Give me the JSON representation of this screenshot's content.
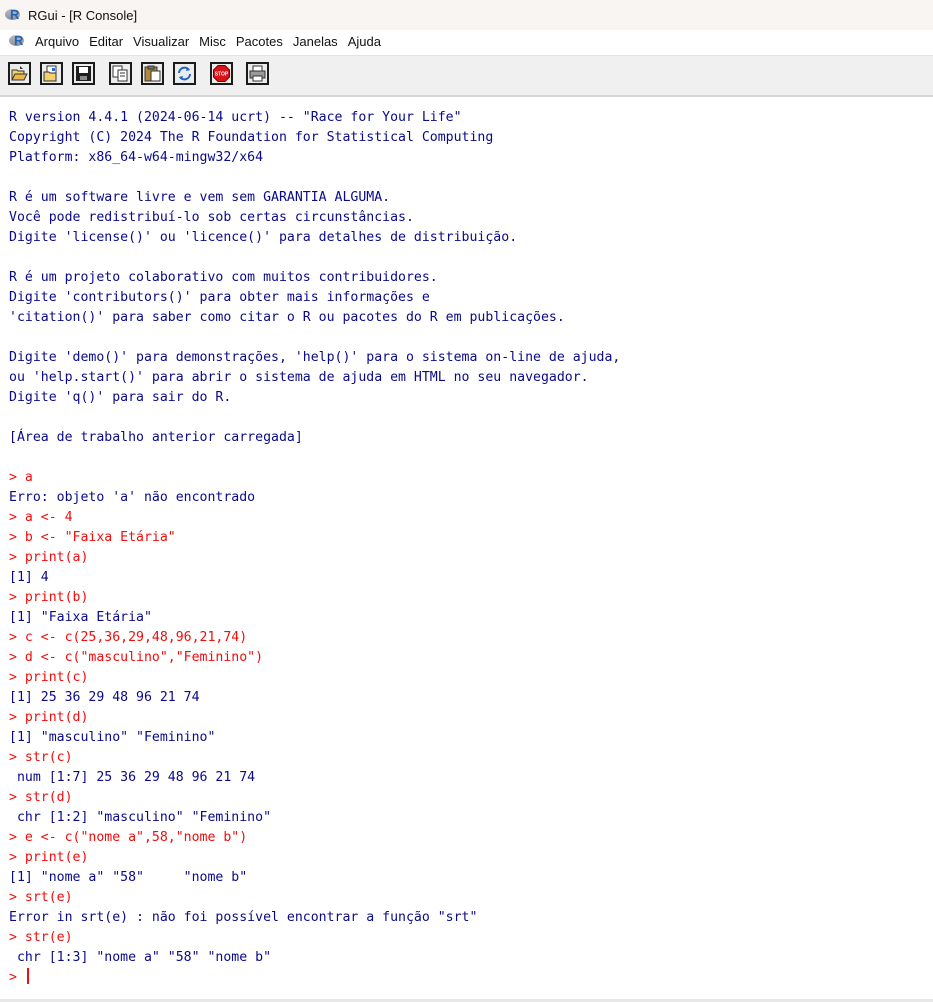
{
  "window": {
    "title": "RGui - [R Console]"
  },
  "menu": {
    "items": [
      {
        "label": "Arquivo"
      },
      {
        "label": "Editar"
      },
      {
        "label": "Visualizar"
      },
      {
        "label": "Misc"
      },
      {
        "label": "Pacotes"
      },
      {
        "label": "Janelas"
      },
      {
        "label": "Ajuda"
      }
    ]
  },
  "toolbar": {
    "buttons": [
      {
        "icon": "open-script-icon"
      },
      {
        "icon": "load-workspace-icon"
      },
      {
        "icon": "save-workspace-icon"
      },
      {
        "icon": "copy-icon"
      },
      {
        "icon": "paste-icon"
      },
      {
        "icon": "copy-paste-icon"
      },
      {
        "icon": "stop-icon"
      },
      {
        "icon": "print-icon"
      }
    ],
    "stop_label": "STOP"
  },
  "colors": {
    "output": "#0a0a8a",
    "input": "#f20d0d"
  },
  "console": {
    "lines": [
      {
        "kind": "out",
        "text": "R version 4.4.1 (2024-06-14 ucrt) -- \"Race for Your Life\""
      },
      {
        "kind": "out",
        "text": "Copyright (C) 2024 The R Foundation for Statistical Computing"
      },
      {
        "kind": "out",
        "text": "Platform: x86_64-w64-mingw32/x64"
      },
      {
        "kind": "blank",
        "text": ""
      },
      {
        "kind": "out",
        "text": "R é um software livre e vem sem GARANTIA ALGUMA."
      },
      {
        "kind": "out",
        "text": "Você pode redistribuí-lo sob certas circunstâncias."
      },
      {
        "kind": "out",
        "text": "Digite 'license()' ou 'licence()' para detalhes de distribuição."
      },
      {
        "kind": "blank",
        "text": ""
      },
      {
        "kind": "out",
        "text": "R é um projeto colaborativo com muitos contribuidores."
      },
      {
        "kind": "out",
        "text": "Digite 'contributors()' para obter mais informações e"
      },
      {
        "kind": "out",
        "text": "'citation()' para saber como citar o R ou pacotes do R em publicações."
      },
      {
        "kind": "blank",
        "text": ""
      },
      {
        "kind": "out",
        "text": "Digite 'demo()' para demonstrações, 'help()' para o sistema on-line de ajuda,"
      },
      {
        "kind": "out",
        "text": "ou 'help.start()' para abrir o sistema de ajuda em HTML no seu navegador."
      },
      {
        "kind": "out",
        "text": "Digite 'q()' para sair do R."
      },
      {
        "kind": "blank",
        "text": ""
      },
      {
        "kind": "out",
        "text": "[Área de trabalho anterior carregada]"
      },
      {
        "kind": "blank",
        "text": ""
      },
      {
        "kind": "in",
        "text": "> a"
      },
      {
        "kind": "out",
        "text": "Erro: objeto 'a' não encontrado"
      },
      {
        "kind": "in",
        "text": "> a <- 4"
      },
      {
        "kind": "in",
        "text": "> b <- \"Faixa Etária\""
      },
      {
        "kind": "in",
        "text": "> print(a)"
      },
      {
        "kind": "out",
        "text": "[1] 4"
      },
      {
        "kind": "in",
        "text": "> print(b)"
      },
      {
        "kind": "out",
        "text": "[1] \"Faixa Etária\""
      },
      {
        "kind": "in",
        "text": "> c <- c(25,36,29,48,96,21,74)"
      },
      {
        "kind": "in",
        "text": "> d <- c(\"masculino\",\"Feminino\")"
      },
      {
        "kind": "in",
        "text": "> print(c)"
      },
      {
        "kind": "out",
        "text": "[1] 25 36 29 48 96 21 74"
      },
      {
        "kind": "in",
        "text": "> print(d)"
      },
      {
        "kind": "out",
        "text": "[1] \"masculino\" \"Feminino\""
      },
      {
        "kind": "in",
        "text": "> str(c)"
      },
      {
        "kind": "out",
        "text": " num [1:7] 25 36 29 48 96 21 74"
      },
      {
        "kind": "in",
        "text": "> str(d)"
      },
      {
        "kind": "out",
        "text": " chr [1:2] \"masculino\" \"Feminino\""
      },
      {
        "kind": "in",
        "text": "> e <- c(\"nome a\",58,\"nome b\")"
      },
      {
        "kind": "in",
        "text": "> print(e)"
      },
      {
        "kind": "out",
        "text": "[1] \"nome a\" \"58\"     \"nome b\""
      },
      {
        "kind": "in",
        "text": "> srt(e)"
      },
      {
        "kind": "out",
        "text": "Error in srt(e) : não foi possível encontrar a função \"srt\""
      },
      {
        "kind": "in",
        "text": "> str(e)"
      },
      {
        "kind": "out",
        "text": " chr [1:3] \"nome a\" \"58\" \"nome b\""
      }
    ],
    "prompt": "> "
  }
}
